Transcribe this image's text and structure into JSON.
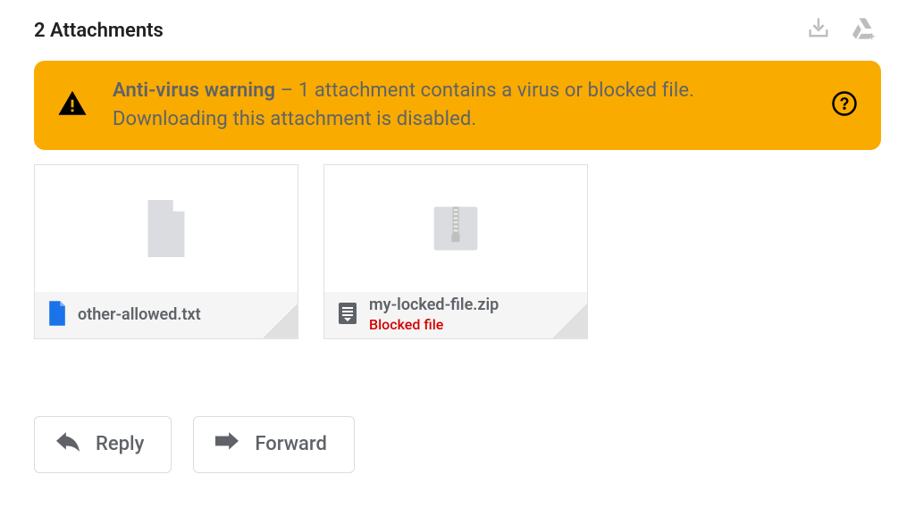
{
  "header": {
    "title": "2 Attachments"
  },
  "banner": {
    "title": "Anti-virus warning",
    "separator": " – ",
    "message": "1 attachment contains a virus or blocked file. Downloading this attachment is disabled."
  },
  "attachments": [
    {
      "filename": "other-allowed.txt",
      "status": null,
      "icon": "file-blue",
      "preview": "file"
    },
    {
      "filename": "my-locked-file.zip",
      "status": "Blocked file",
      "icon": "archive-grey",
      "preview": "zip"
    }
  ],
  "actions": {
    "reply": "Reply",
    "forward": "Forward"
  }
}
